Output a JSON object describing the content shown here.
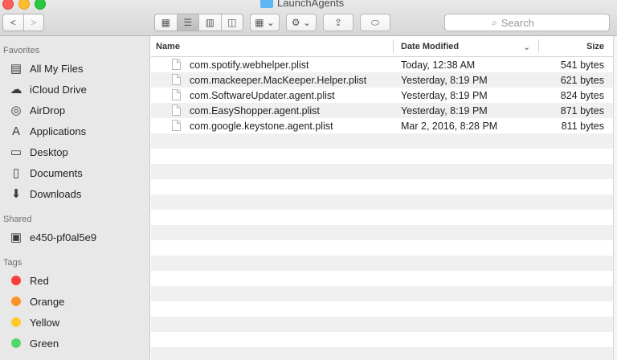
{
  "window": {
    "title": "LaunchAgents"
  },
  "toolbar": {
    "back": "<",
    "forward": ">",
    "view_icons": "▦",
    "view_list": "☰",
    "view_columns": "▥",
    "view_coverflow": "◫",
    "arrange": "▦ ⌄",
    "action": "⚙ ⌄",
    "share": "⇪",
    "tags": "⬭",
    "search_placeholder": "Search",
    "search_icon": "⌕"
  },
  "sidebar": {
    "favorites_header": "Favorites",
    "favorites": [
      {
        "label": "All My Files",
        "icon": "all-files-icon",
        "glyph": "▤"
      },
      {
        "label": "iCloud Drive",
        "icon": "cloud-icon",
        "glyph": "☁"
      },
      {
        "label": "AirDrop",
        "icon": "airdrop-icon",
        "glyph": "◎"
      },
      {
        "label": "Applications",
        "icon": "applications-icon",
        "glyph": "A"
      },
      {
        "label": "Desktop",
        "icon": "desktop-icon",
        "glyph": "▭"
      },
      {
        "label": "Documents",
        "icon": "documents-icon",
        "glyph": "▯"
      },
      {
        "label": "Downloads",
        "icon": "downloads-icon",
        "glyph": "⬇"
      }
    ],
    "shared_header": "Shared",
    "shared": [
      {
        "label": "e450-pf0al5e9",
        "icon": "computer-icon",
        "glyph": "▣"
      }
    ],
    "tags_header": "Tags",
    "tags": [
      {
        "label": "Red",
        "color": "#fc3d39"
      },
      {
        "label": "Orange",
        "color": "#fd9426"
      },
      {
        "label": "Yellow",
        "color": "#fecb2f"
      },
      {
        "label": "Green",
        "color": "#53d769"
      }
    ]
  },
  "list": {
    "columns": {
      "name": "Name",
      "date": "Date Modified",
      "size": "Size",
      "sort_glyph": "⌄"
    },
    "rows": [
      {
        "name": "com.spotify.webhelper.plist",
        "date": "Today, 12:38 AM",
        "size": "541 bytes"
      },
      {
        "name": "com.mackeeper.MacKeeper.Helper.plist",
        "date": "Yesterday, 8:19 PM",
        "size": "621 bytes"
      },
      {
        "name": "com.SoftwareUpdater.agent.plist",
        "date": "Yesterday, 8:19 PM",
        "size": "824 bytes"
      },
      {
        "name": "com.EasyShopper.agent.plist",
        "date": "Yesterday, 8:19 PM",
        "size": "871 bytes"
      },
      {
        "name": "com.google.keystone.agent.plist",
        "date": "Mar 2, 2016, 8:28 PM",
        "size": "811 bytes"
      }
    ]
  }
}
